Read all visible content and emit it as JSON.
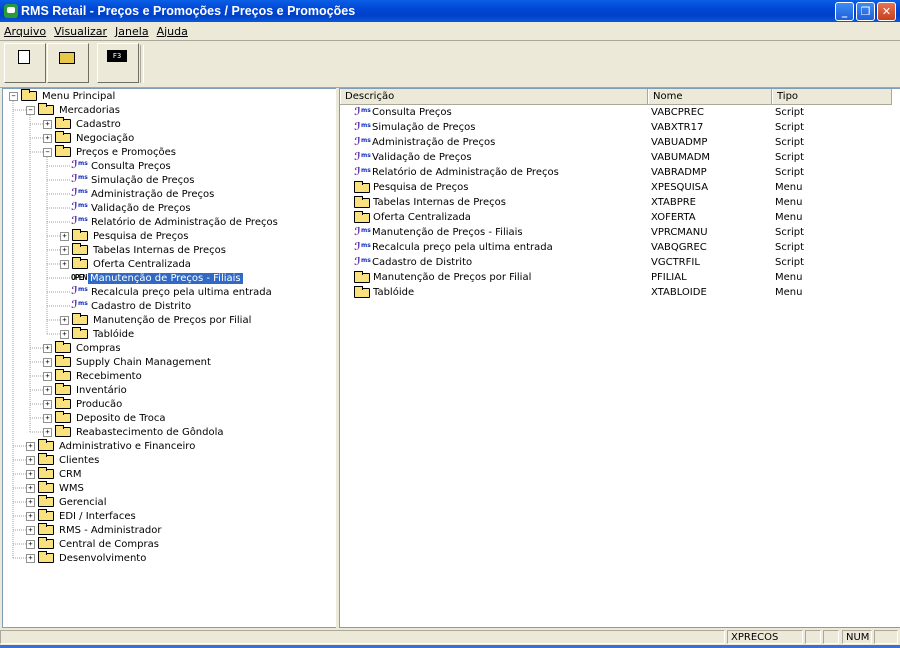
{
  "window": {
    "title": "RMS Retail - Preços e Promoções / Preços e Promoções"
  },
  "menu": [
    "Arquivo",
    "Visualizar",
    "Janela",
    "Ajuda"
  ],
  "toolbar": {
    "f3_label": "F3"
  },
  "tree": [
    {
      "label": "Menu Principal",
      "level": 0,
      "icon": "folder",
      "toggle": "-"
    },
    {
      "label": "Mercadorias",
      "level": 1,
      "icon": "folder",
      "toggle": "-"
    },
    {
      "label": "Cadastro",
      "level": 2,
      "icon": "folder",
      "toggle": "+"
    },
    {
      "label": "Negociação",
      "level": 2,
      "icon": "folder",
      "toggle": "+"
    },
    {
      "label": "Preços e Promoções",
      "level": 2,
      "icon": "folder",
      "toggle": "-"
    },
    {
      "label": "Consulta Preços",
      "level": 3,
      "icon": "script",
      "toggle": ""
    },
    {
      "label": "Simulação de Preços",
      "level": 3,
      "icon": "script",
      "toggle": ""
    },
    {
      "label": "Administração de Preços",
      "level": 3,
      "icon": "script",
      "toggle": ""
    },
    {
      "label": "Validação de Preços",
      "level": 3,
      "icon": "script",
      "toggle": ""
    },
    {
      "label": "Relatório de Administração de Preços",
      "level": 3,
      "icon": "script",
      "toggle": ""
    },
    {
      "label": "Pesquisa de Preços",
      "level": 3,
      "icon": "folder",
      "toggle": "+"
    },
    {
      "label": "Tabelas Internas de Preços",
      "level": 3,
      "icon": "folder",
      "toggle": "+"
    },
    {
      "label": "Oferta Centralizada",
      "level": 3,
      "icon": "folder",
      "toggle": "+"
    },
    {
      "label": "Manutenção de Preços - Filiais",
      "level": 3,
      "icon": "open",
      "toggle": "",
      "selected": true
    },
    {
      "label": "Recalcula preço pela ultima entrada",
      "level": 3,
      "icon": "script",
      "toggle": ""
    },
    {
      "label": "Cadastro de Distrito",
      "level": 3,
      "icon": "script",
      "toggle": ""
    },
    {
      "label": "Manutenção de Preços por Filial",
      "level": 3,
      "icon": "folder",
      "toggle": "+"
    },
    {
      "label": "Tablóide",
      "level": 3,
      "icon": "folder",
      "toggle": "+"
    },
    {
      "label": "Compras",
      "level": 2,
      "icon": "folder",
      "toggle": "+"
    },
    {
      "label": "Supply Chain Management",
      "level": 2,
      "icon": "folder",
      "toggle": "+"
    },
    {
      "label": "Recebimento",
      "level": 2,
      "icon": "folder",
      "toggle": "+"
    },
    {
      "label": "Inventário",
      "level": 2,
      "icon": "folder",
      "toggle": "+"
    },
    {
      "label": "Producão",
      "level": 2,
      "icon": "folder",
      "toggle": "+"
    },
    {
      "label": "Deposito de Troca",
      "level": 2,
      "icon": "folder",
      "toggle": "+"
    },
    {
      "label": "Reabastecimento de Gôndola",
      "level": 2,
      "icon": "folder",
      "toggle": "+"
    },
    {
      "label": "Administrativo e Financeiro",
      "level": 1,
      "icon": "folder",
      "toggle": "+"
    },
    {
      "label": "Clientes",
      "level": 1,
      "icon": "folder",
      "toggle": "+"
    },
    {
      "label": "CRM",
      "level": 1,
      "icon": "folder",
      "toggle": "+"
    },
    {
      "label": "WMS",
      "level": 1,
      "icon": "folder",
      "toggle": "+"
    },
    {
      "label": "Gerencial",
      "level": 1,
      "icon": "folder",
      "toggle": "+"
    },
    {
      "label": "EDI / Interfaces",
      "level": 1,
      "icon": "folder",
      "toggle": "+"
    },
    {
      "label": "RMS - Administrador",
      "level": 1,
      "icon": "folder",
      "toggle": "+"
    },
    {
      "label": "Central de Compras",
      "level": 1,
      "icon": "folder",
      "toggle": "+"
    },
    {
      "label": "Desenvolvimento",
      "level": 1,
      "icon": "folder",
      "toggle": "+"
    }
  ],
  "list": {
    "columns": [
      "Descrição",
      "Nome",
      "Tipo"
    ],
    "rows": [
      {
        "desc": "Consulta Preços",
        "nome": "VABCPREC",
        "tipo": "Script",
        "icon": "script"
      },
      {
        "desc": "Simulação de Preços",
        "nome": "VABXTR17",
        "tipo": "Script",
        "icon": "script"
      },
      {
        "desc": "Administração de Preços",
        "nome": "VABUADMP",
        "tipo": "Script",
        "icon": "script"
      },
      {
        "desc": "Validação de Preços",
        "nome": "VABUMADM",
        "tipo": "Script",
        "icon": "script"
      },
      {
        "desc": "Relatório de Administração de Preços",
        "nome": "VABRADMP",
        "tipo": "Script",
        "icon": "script"
      },
      {
        "desc": "Pesquisa de Preços",
        "nome": "XPESQUISA",
        "tipo": "Menu",
        "icon": "folder"
      },
      {
        "desc": "Tabelas Internas de Preços",
        "nome": "XTABPRE",
        "tipo": "Menu",
        "icon": "folder"
      },
      {
        "desc": "Oferta Centralizada",
        "nome": "XOFERTA",
        "tipo": "Menu",
        "icon": "folder"
      },
      {
        "desc": "Manutenção de Preços - Filiais",
        "nome": "VPRCMANU",
        "tipo": "Script",
        "icon": "script"
      },
      {
        "desc": "Recalcula preço pela ultima entrada",
        "nome": "VABQGREC",
        "tipo": "Script",
        "icon": "script"
      },
      {
        "desc": "Cadastro de Distrito",
        "nome": "VGCTRFIL",
        "tipo": "Script",
        "icon": "script"
      },
      {
        "desc": "Manutenção de Preços por Filial",
        "nome": "PFILIAL",
        "tipo": "Menu",
        "icon": "folder"
      },
      {
        "desc": "Tablóide",
        "nome": "XTABLOIDE",
        "tipo": "Menu",
        "icon": "folder"
      }
    ]
  },
  "status": {
    "module": "XPRECOS",
    "numlock": "NUM"
  }
}
